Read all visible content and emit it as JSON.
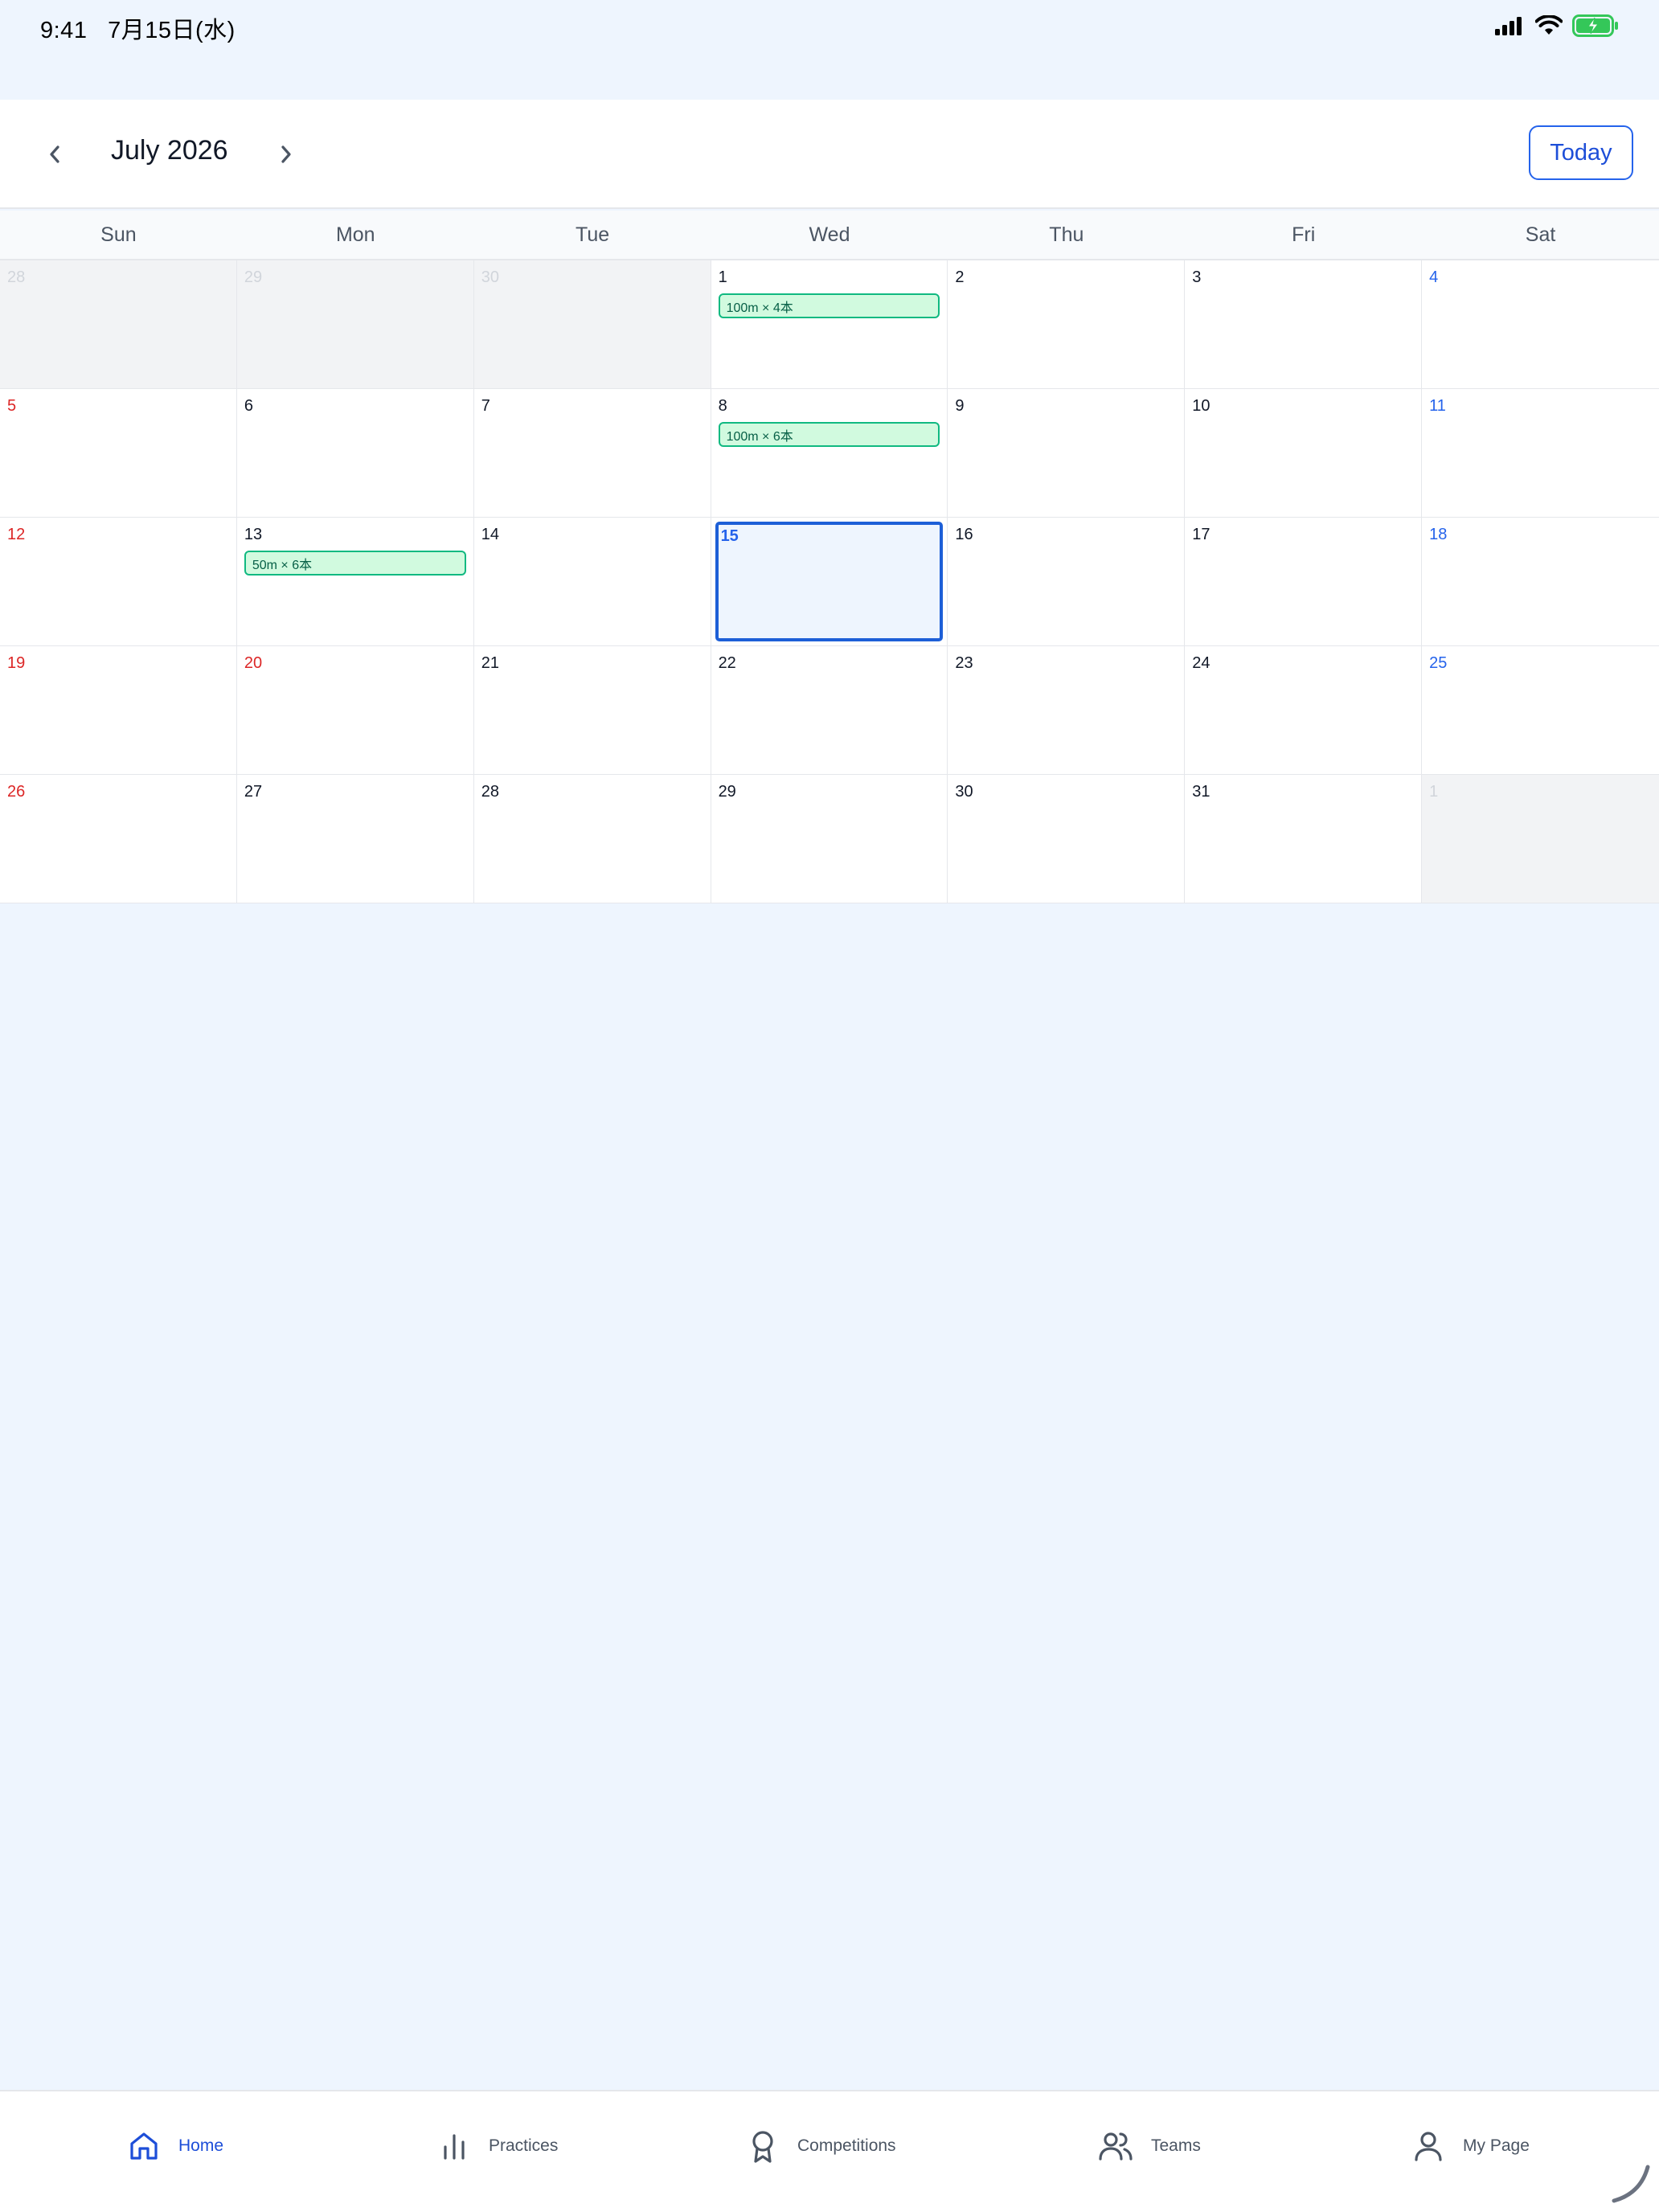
{
  "status_bar": {
    "time": "9:41",
    "date": "7月15日(水)"
  },
  "header": {
    "month_title": "July 2026",
    "today_label": "Today"
  },
  "weekdays": [
    "Sun",
    "Mon",
    "Tue",
    "Wed",
    "Thu",
    "Fri",
    "Sat"
  ],
  "weeks": [
    [
      {
        "day": "28",
        "outside": true
      },
      {
        "day": "29",
        "outside": true
      },
      {
        "day": "30",
        "outside": true
      },
      {
        "day": "1",
        "event": "100m × 4本"
      },
      {
        "day": "2"
      },
      {
        "day": "3"
      },
      {
        "day": "4"
      }
    ],
    [
      {
        "day": "5"
      },
      {
        "day": "6"
      },
      {
        "day": "7"
      },
      {
        "day": "8",
        "event": "100m × 6本"
      },
      {
        "day": "9"
      },
      {
        "day": "10"
      },
      {
        "day": "11"
      }
    ],
    [
      {
        "day": "12"
      },
      {
        "day": "13",
        "event": "50m × 6本"
      },
      {
        "day": "14"
      },
      {
        "day": "15",
        "today": true
      },
      {
        "day": "16"
      },
      {
        "day": "17"
      },
      {
        "day": "18"
      }
    ],
    [
      {
        "day": "19"
      },
      {
        "day": "20",
        "holiday": true
      },
      {
        "day": "21"
      },
      {
        "day": "22"
      },
      {
        "day": "23"
      },
      {
        "day": "24"
      },
      {
        "day": "25"
      }
    ],
    [
      {
        "day": "26"
      },
      {
        "day": "27"
      },
      {
        "day": "28"
      },
      {
        "day": "29"
      },
      {
        "day": "30"
      },
      {
        "day": "31"
      },
      {
        "day": "1",
        "outside": true
      }
    ]
  ],
  "tabs": [
    {
      "label": "Home",
      "icon": "home-icon",
      "active": true
    },
    {
      "label": "Practices",
      "icon": "bar-chart-icon"
    },
    {
      "label": "Competitions",
      "icon": "award-icon"
    },
    {
      "label": "Teams",
      "icon": "users-icon"
    },
    {
      "label": "My Page",
      "icon": "user-icon"
    }
  ],
  "colors": {
    "accent": "#1D4ED8",
    "sunday": "#DC2626",
    "saturday": "#2563EB",
    "event_bg": "#D1FADF",
    "event_border": "#10B981",
    "page_bg": "#EEF5FE"
  }
}
